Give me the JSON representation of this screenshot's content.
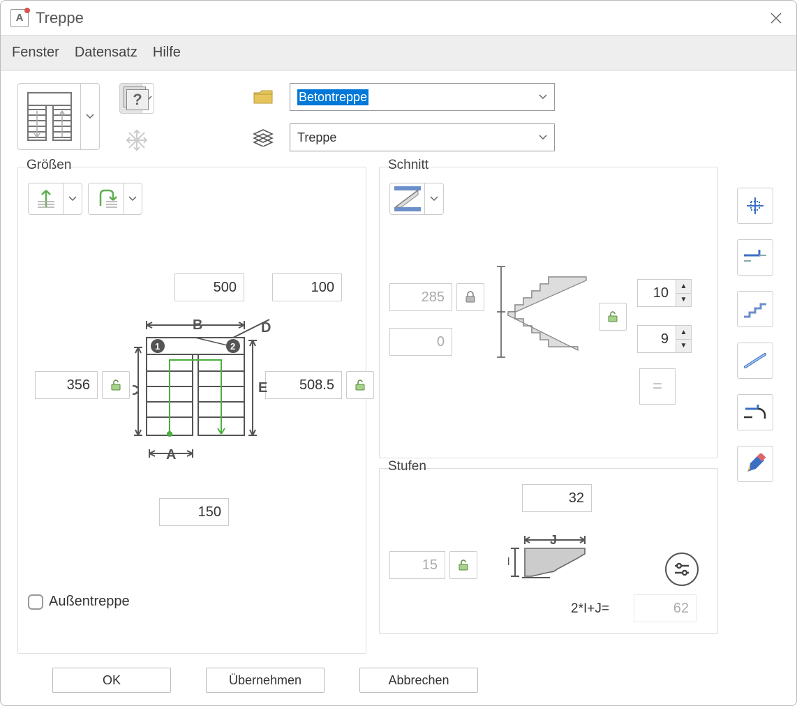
{
  "window": {
    "title": "Treppe"
  },
  "menu": {
    "fenster": "Fenster",
    "datensatz": "Datensatz",
    "hilfe": "Hilfe"
  },
  "selects": {
    "type_label": "Betontreppe",
    "layer_label": "Treppe"
  },
  "sizes": {
    "label": "Größen",
    "val_b": "500",
    "val_d": "100",
    "val_c": "356",
    "val_e": "508.5",
    "val_a": "150",
    "aussen_label": "Außentreppe"
  },
  "schnitt": {
    "label": "Schnitt",
    "val_285": "285",
    "val_0": "0",
    "spin1": "10",
    "spin2": "9"
  },
  "stufen": {
    "label": "Stufen",
    "val_32": "32",
    "val_15": "15",
    "formula_label": "2*I+J=",
    "formula_val": "62"
  },
  "footer": {
    "ok": "OK",
    "apply": "Übernehmen",
    "cancel": "Abbrechen"
  }
}
